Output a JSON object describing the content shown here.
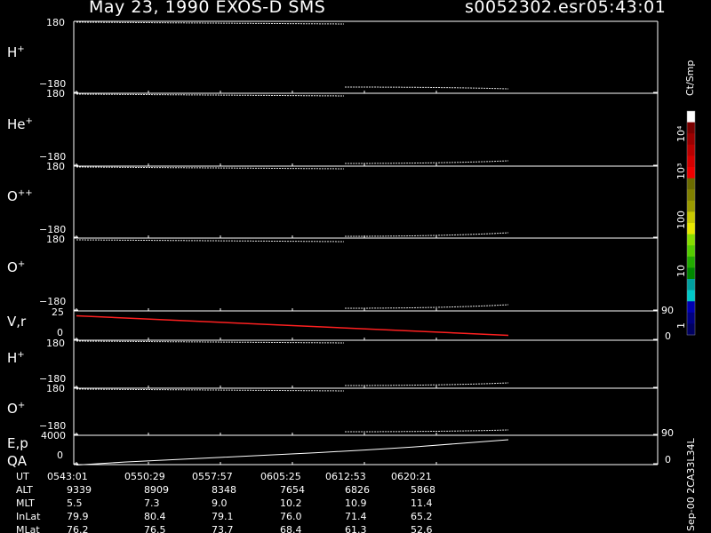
{
  "header": {
    "title": "May 23, 1990   EXOS-D SMS",
    "file": "s0052302.esr",
    "time": "05:43:01"
  },
  "panels": [
    {
      "label": "H",
      "sup": "+",
      "top_tick": "180",
      "bottom_tick": "−180"
    },
    {
      "label": "He",
      "sup": "+",
      "top_tick": "180",
      "bottom_tick": "−180"
    },
    {
      "label": "O",
      "sup": "++",
      "top_tick": "180",
      "bottom_tick": "−180"
    },
    {
      "label": "O",
      "sup": "+",
      "top_tick": "180",
      "bottom_tick": "−180"
    },
    {
      "label": "V,r",
      "sup": "",
      "top_tick": "25",
      "bottom_tick": "0",
      "right_top": "90",
      "right_bottom": "0"
    },
    {
      "label": "H",
      "sup": "+",
      "top_tick": "180",
      "bottom_tick": "−180"
    },
    {
      "label": "O",
      "sup": "+",
      "top_tick": "180",
      "bottom_tick": "−180"
    },
    {
      "label": "E,p",
      "label2": "QA",
      "sup": "",
      "top_tick": "4000",
      "bottom_tick": "0",
      "right_top": "90",
      "right_bottom": "0"
    }
  ],
  "colorbar": {
    "unit": "Ct/Smp",
    "ticks": [
      "10⁴",
      "10³",
      "100",
      "10",
      "1"
    ],
    "colors": [
      "#ffffff",
      "#7a0000",
      "#9a0000",
      "#b80000",
      "#d40000",
      "#ee0000",
      "#6b6b00",
      "#808000",
      "#9a9a00",
      "#c8c800",
      "#e8e800",
      "#88dd00",
      "#55cc00",
      "#22aa00",
      "#008800",
      "#00a0a0",
      "#00c8c8",
      "#0000b0",
      "#000080",
      "#000060"
    ]
  },
  "side_note": "Sep-00  2CA33L34L",
  "ephemeris": {
    "rows": [
      {
        "name": "UT",
        "values": [
          "0543:01",
          "0550:29",
          "0557:57",
          "0605:25",
          "0612:53",
          "0620:21"
        ]
      },
      {
        "name": "ALT",
        "values": [
          "9339",
          "8909",
          "8348",
          "7654",
          "6826",
          "5868"
        ]
      },
      {
        "name": "MLT",
        "values": [
          "5.5",
          "7.3",
          "9.0",
          "10.2",
          "10.9",
          "11.4"
        ]
      },
      {
        "name": "InLat",
        "values": [
          "79.9",
          "80.4",
          "79.1",
          "76.0",
          "71.4",
          "65.2"
        ]
      },
      {
        "name": "MLat",
        "values": [
          "76.2",
          "76.5",
          "73.7",
          "68.4",
          "61.3",
          "52.6"
        ]
      }
    ]
  },
  "chart_data": {
    "type": "line",
    "x_label": "UT",
    "x_ticks": [
      "0543:01",
      "0550:29",
      "0557:57",
      "0605:25",
      "0612:53",
      "0620:21"
    ],
    "x_range_minutes": [
      0,
      45
    ],
    "series": [
      {
        "panel": "V,r",
        "color": "#ff2020",
        "x": [
          0,
          45
        ],
        "y": [
          22,
          3
        ]
      },
      {
        "panel": "E,p",
        "color": "#ffffff",
        "x": [
          0,
          5,
          10,
          15,
          20,
          25,
          30,
          35,
          40,
          45
        ],
        "y": [
          -200,
          250,
          600,
          950,
          1300,
          1650,
          2050,
          2500,
          3050,
          3600
        ]
      }
    ],
    "panel_ylim": {
      "H+": [
        -180,
        180
      ],
      "He+": [
        -180,
        180
      ],
      "O++": [
        -180,
        180
      ],
      "O+": [
        -180,
        180
      ],
      "V,r": [
        0,
        25
      ],
      "E,p": [
        0,
        4000
      ]
    }
  }
}
